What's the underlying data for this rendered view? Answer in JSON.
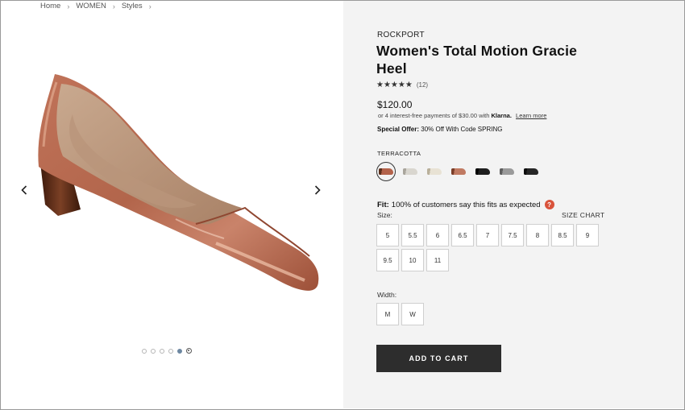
{
  "breadcrumb": [
    {
      "label": "Home"
    },
    {
      "label": "WOMEN"
    },
    {
      "label": "Styles"
    }
  ],
  "gallery": {
    "image_alt": "Women's Total Motion Gracie Heel - Terracotta",
    "dot_count": 6,
    "active_dot": 4,
    "colors": {
      "active_dot": "#6d87a1"
    }
  },
  "product": {
    "brand": "ROCKPORT",
    "title": "Women's Total Motion Gracie Heel",
    "rating": 4.5,
    "stars": "★★★★★",
    "review_count": "(12)",
    "price": "$120.00",
    "installments_text": "or 4 interest-free payments of $30.00 with",
    "klarna": "Klarna.",
    "learn_more": "Learn more",
    "offer_label": "Special Offer:",
    "offer_text": "30% Off With Code SPRING"
  },
  "color": {
    "label": "TERRACOTTA",
    "swatches": [
      {
        "color": "#b3624a",
        "sole": "#5a2f1c",
        "selected": true
      },
      {
        "color": "#d9d6cf",
        "sole": "#a9a59c",
        "selected": false
      },
      {
        "color": "#e8e2d4",
        "sole": "#b9b09b",
        "selected": false
      },
      {
        "color": "#c07a62",
        "sole": "#7a3d28",
        "selected": false
      },
      {
        "color": "#1e1e1e",
        "sole": "#000000",
        "selected": false
      },
      {
        "color": "#9a9a9a",
        "sole": "#5e5e5e",
        "selected": false
      },
      {
        "color": "#262626",
        "sole": "#0c0c0c",
        "selected": false
      }
    ]
  },
  "fit": {
    "label": "Fit:",
    "text": "100% of customers say this fits as expected",
    "help": "?"
  },
  "size": {
    "label": "Size:",
    "chart_link": "SIZE CHART",
    "options": [
      "5",
      "5.5",
      "6",
      "6.5",
      "7",
      "7.5",
      "8",
      "8.5",
      "9",
      "9.5",
      "10",
      "11"
    ]
  },
  "width": {
    "label": "Width:",
    "options": [
      "M",
      "W"
    ]
  },
  "cart": {
    "label": "ADD TO CART"
  }
}
